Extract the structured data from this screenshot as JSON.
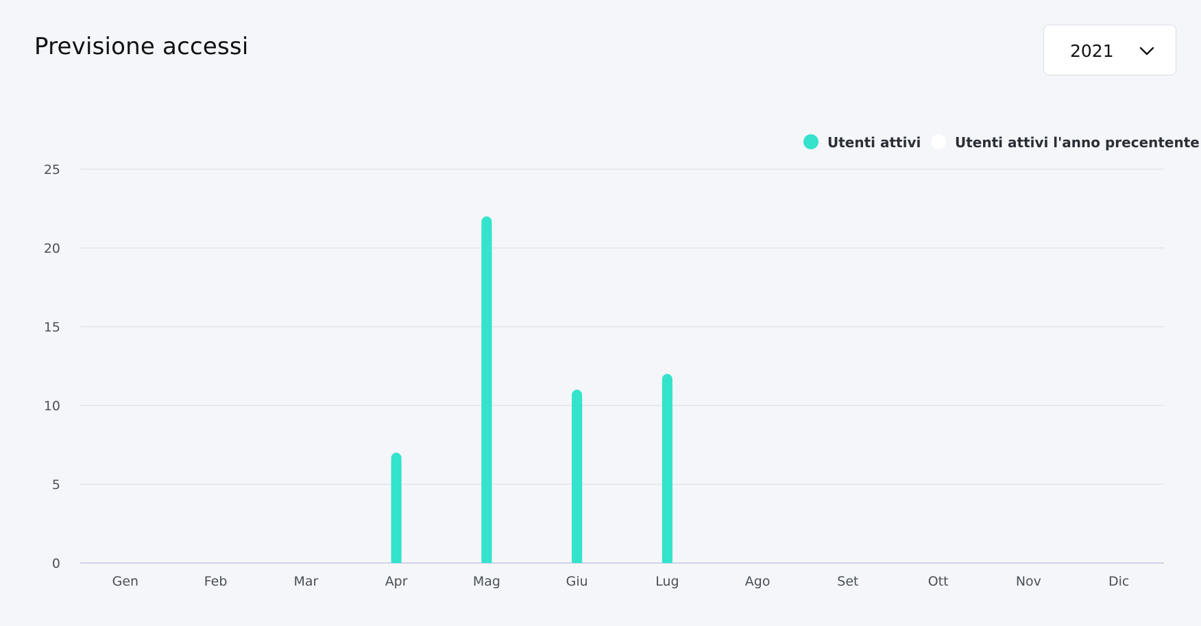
{
  "header": {
    "title": "Previsione accessi",
    "year_selected": "2021"
  },
  "colors": {
    "current": "#33e3cc",
    "previous": "#ffffff",
    "grid": "#e2e5ea",
    "axis": "#cfd3e6"
  },
  "chart_data": {
    "type": "bar",
    "title": "Previsione accessi",
    "xlabel": "",
    "ylabel": "",
    "ylim": [
      0,
      25
    ],
    "yticks": [
      0,
      5,
      10,
      15,
      20,
      25
    ],
    "grid": true,
    "legend_position": "top-right",
    "categories": [
      "Gen",
      "Feb",
      "Mar",
      "Apr",
      "Mag",
      "Giu",
      "Lug",
      "Ago",
      "Set",
      "Ott",
      "Nov",
      "Dic"
    ],
    "series": [
      {
        "name": "Utenti attivi",
        "color": "#33e3cc",
        "values": [
          0,
          0,
          0,
          7,
          22,
          11,
          12,
          0,
          0,
          0,
          0,
          0
        ]
      },
      {
        "name": "Utenti attivi l'anno precentente",
        "color": "#ffffff",
        "values": [
          0,
          0,
          0,
          0,
          0,
          0,
          0,
          0,
          0,
          0,
          0,
          0
        ]
      }
    ]
  }
}
